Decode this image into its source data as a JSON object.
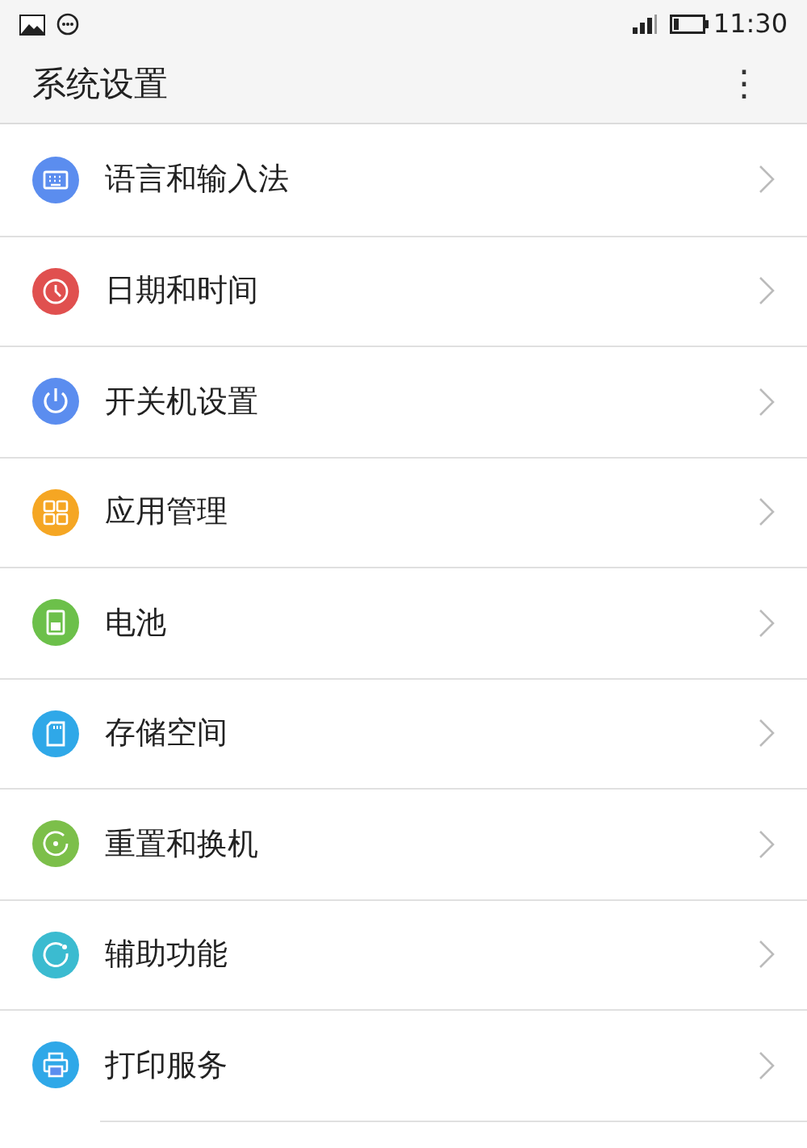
{
  "status_bar": {
    "time": "11:30"
  },
  "app_bar": {
    "title": "系统设置",
    "menu": "⋮"
  },
  "items": [
    {
      "label": "语言和输入法",
      "color": "#5b8def"
    },
    {
      "label": "日期和时间",
      "color": "#e0504f"
    },
    {
      "label": "开关机设置",
      "color": "#5b8def"
    },
    {
      "label": "应用管理",
      "color": "#f5a623"
    },
    {
      "label": "电池",
      "color": "#6cc04a"
    },
    {
      "label": "存储空间",
      "color": "#2fa8e8"
    },
    {
      "label": "重置和换机",
      "color": "#7cbf4a"
    },
    {
      "label": "辅助功能",
      "color": "#3bbbd0"
    },
    {
      "label": "打印服务",
      "color": "#2fa8e8"
    }
  ]
}
